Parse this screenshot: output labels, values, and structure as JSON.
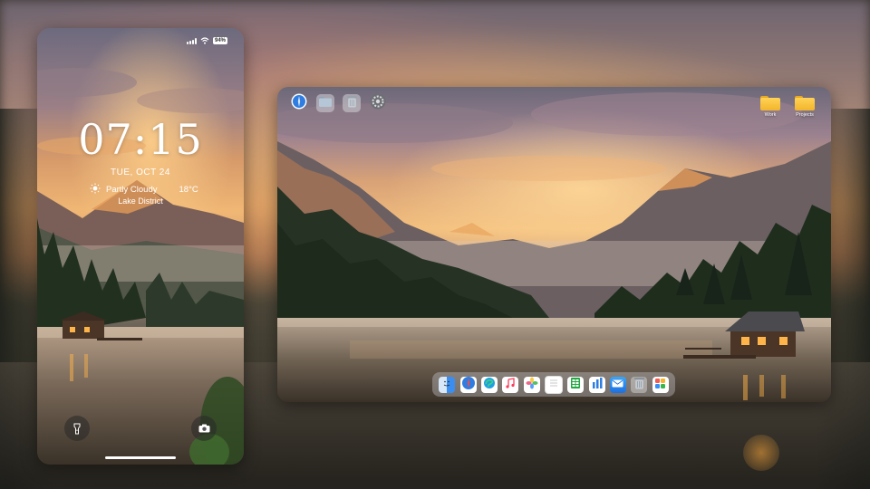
{
  "colors": {
    "accent_blue": "#2f7de1",
    "folder_yellow": "#f7c23b",
    "sunset_orange": "#e7a05a"
  },
  "phone": {
    "status": {
      "signal_icon": "signal-icon",
      "wifi_icon": "wifi-icon",
      "battery": "94%"
    },
    "time": "07:15",
    "date": "TUE, OCT 24",
    "weather": {
      "icon": "sun-icon",
      "condition": "Partly Cloudy",
      "temperature": "18°C"
    },
    "location": "Lake District",
    "buttons": [
      {
        "name": "flashlight",
        "icon": "flashlight-icon"
      },
      {
        "name": "camera",
        "icon": "camera-icon"
      }
    ]
  },
  "tablet": {
    "top_icons": [
      {
        "name": "safari",
        "icon": "safari-icon"
      },
      {
        "name": "folder",
        "icon": "folder-icon"
      },
      {
        "name": "trash",
        "icon": "trash-icon"
      },
      {
        "name": "settings",
        "icon": "gear-icon"
      }
    ],
    "desktop_folders": [
      {
        "label": "Work",
        "icon": "folder-icon"
      },
      {
        "label": "Projects",
        "icon": "folder-icon"
      }
    ],
    "dock": [
      {
        "name": "finder",
        "icon": "finder-icon"
      },
      {
        "name": "safari",
        "icon": "safari-icon"
      },
      {
        "name": "edge",
        "icon": "edge-icon"
      },
      {
        "name": "music",
        "icon": "music-icon"
      },
      {
        "name": "photos",
        "icon": "photos-icon"
      },
      {
        "name": "notes",
        "icon": "notes-icon"
      },
      {
        "name": "numbers",
        "icon": "numbers-icon"
      },
      {
        "name": "keynote",
        "icon": "keynote-icon"
      },
      {
        "name": "mail",
        "icon": "mail-icon"
      },
      {
        "name": "trash",
        "icon": "trash-icon"
      },
      {
        "name": "launchpad",
        "icon": "launchpad-icon"
      }
    ]
  }
}
